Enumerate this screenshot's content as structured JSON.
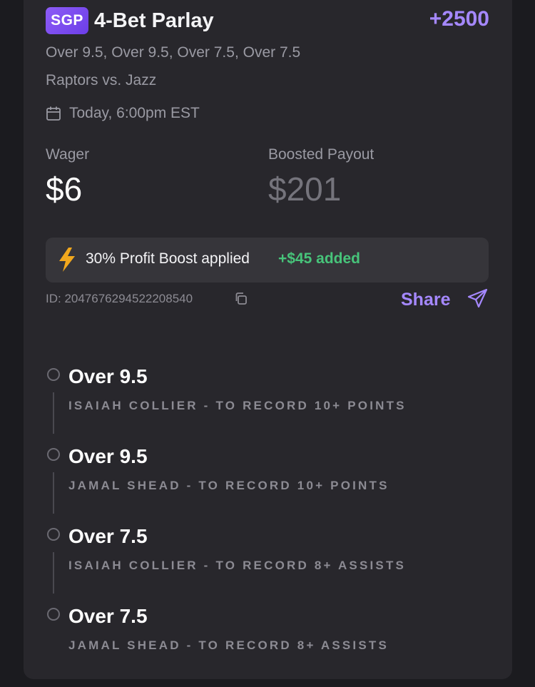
{
  "bet": {
    "badge": "SGP",
    "title": "4-Bet Parlay",
    "odds": "+2500",
    "selections": "Over 9.5, Over 9.5, Over 7.5, Over 7.5",
    "matchup": "Raptors vs. Jazz",
    "datetime": "Today, 6:00pm EST"
  },
  "amounts": {
    "wager_label": "Wager",
    "wager_value": "$6",
    "payout_label": "Boosted Payout",
    "payout_value": "$201"
  },
  "boost": {
    "text": "30% Profit Boost applied",
    "added": "+$45 added"
  },
  "footer": {
    "id_text": "ID: 2047676294522208540",
    "share_label": "Share"
  },
  "legs": [
    {
      "title": "Over 9.5",
      "description": "ISAIAH COLLIER - TO RECORD 10+ POINTS"
    },
    {
      "title": "Over 9.5",
      "description": "JAMAL SHEAD - TO RECORD 10+ POINTS"
    },
    {
      "title": "Over 7.5",
      "description": "ISAIAH COLLIER - TO RECORD 8+ ASSISTS"
    },
    {
      "title": "Over 7.5",
      "description": "JAMAL SHEAD - TO RECORD 8+ ASSISTS"
    }
  ],
  "icons": {
    "calendar": "calendar-icon",
    "bolt": "lightning-bolt-icon",
    "copy": "copy-icon",
    "share": "send-icon",
    "leg_status": "empty-circle-icon"
  },
  "colors": {
    "background": "#1b1b1f",
    "card": "#28272c",
    "accent": "#a588ff",
    "boost_green": "#47c47a",
    "bolt_yellow": "#f2a81d"
  }
}
